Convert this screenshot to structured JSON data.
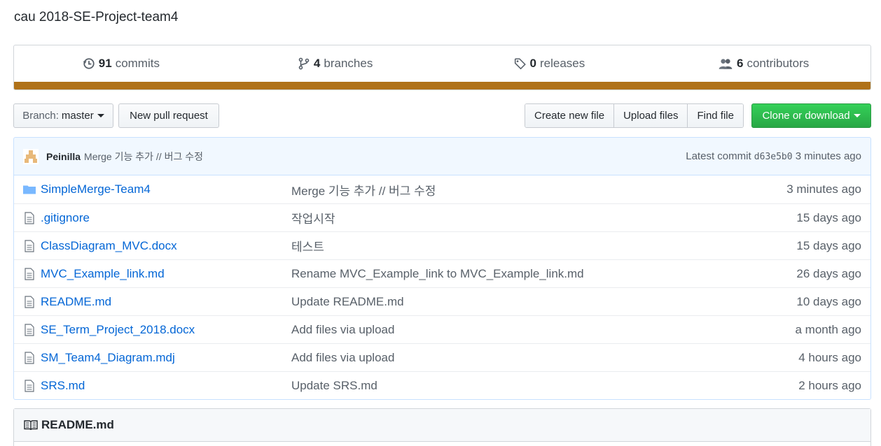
{
  "repo": {
    "description": "cau 2018-SE-Project-team4"
  },
  "summary": {
    "commits": {
      "num": "91",
      "label": "commits",
      "icon": "history-icon"
    },
    "branches": {
      "num": "4",
      "label": "branches",
      "icon": "git-branch-icon"
    },
    "releases": {
      "num": "0",
      "label": "releases",
      "icon": "tag-icon"
    },
    "contributors": {
      "num": "6",
      "label": "contributors",
      "icon": "people-icon"
    },
    "language_color": "#b07219"
  },
  "toolbar": {
    "branch_label": "Branch:",
    "branch_value": "master",
    "new_pull_request": "New pull request",
    "create_new_file": "Create new file",
    "upload_files": "Upload files",
    "find_file": "Find file",
    "clone_or_download": "Clone or download",
    "clone_color": "#28a745"
  },
  "latest_commit": {
    "author": "Peinilla",
    "message": "Merge 기능 추가 // 버그 수정",
    "prefix": "Latest commit",
    "sha": "d63e5b0",
    "time": "3 minutes ago"
  },
  "files": [
    {
      "type": "directory",
      "name": "SimpleMerge-Team4",
      "message": "Merge 기능 추가 // 버그 수정",
      "age": "3 minutes ago"
    },
    {
      "type": "file",
      "name": ".gitignore",
      "message": "작업시작",
      "age": "15 days ago"
    },
    {
      "type": "file",
      "name": "ClassDiagram_MVC.docx",
      "message": "테스트",
      "age": "15 days ago"
    },
    {
      "type": "file",
      "name": "MVC_Example_link.md",
      "message": "Rename MVC_Example_link to MVC_Example_link.md",
      "age": "26 days ago"
    },
    {
      "type": "file",
      "name": "README.md",
      "message": "Update README.md",
      "age": "10 days ago"
    },
    {
      "type": "file",
      "name": "SE_Term_Project_2018.docx",
      "message": "Add files via upload",
      "age": "a month ago"
    },
    {
      "type": "file",
      "name": "SM_Team4_Diagram.mdj",
      "message": "Add files via upload",
      "age": "4 hours ago"
    },
    {
      "type": "file",
      "name": "SRS.md",
      "message": "Update SRS.md",
      "age": "2 hours ago"
    }
  ],
  "readme": {
    "title": "README.md",
    "icon": "book-icon"
  }
}
